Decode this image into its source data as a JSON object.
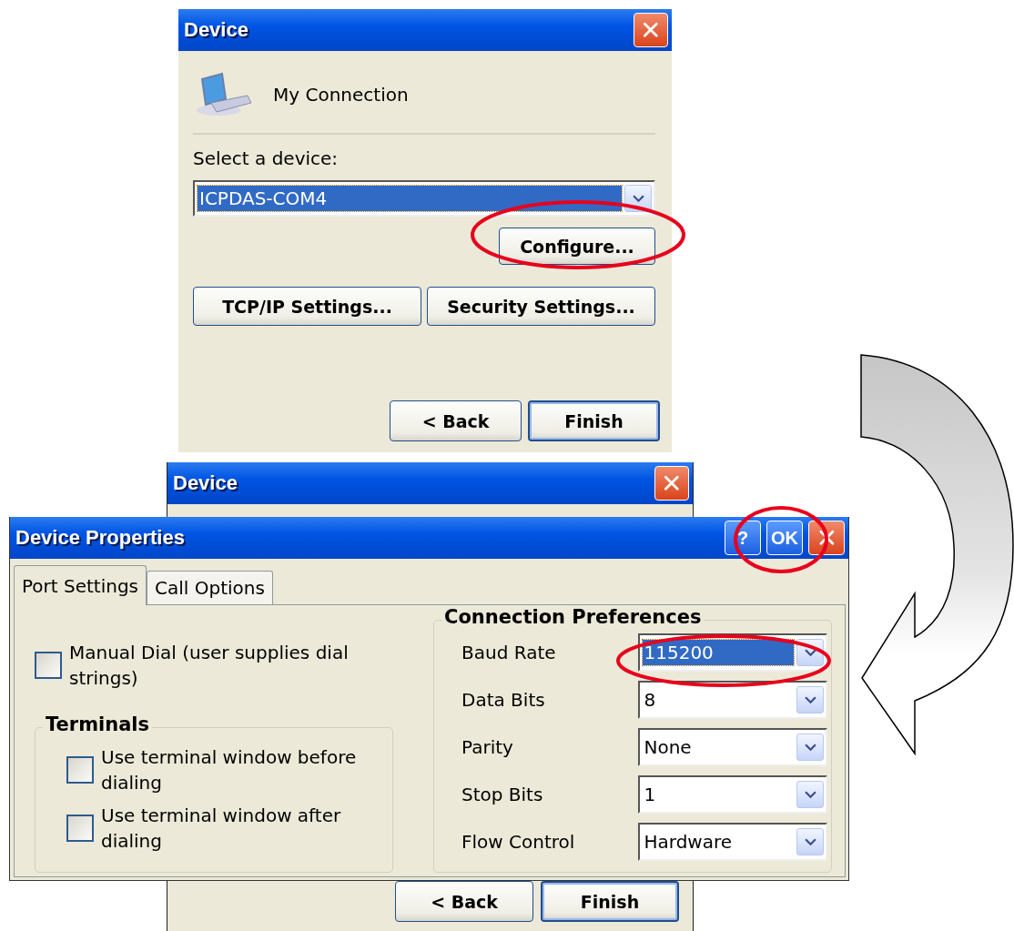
{
  "top_window": {
    "title": "Device",
    "connection_name": "My Connection",
    "select_label": "Select a device:",
    "device_dropdown": {
      "value": "ICPDAS-COM4",
      "highlighted": true
    },
    "configure_button": "Configure...",
    "settings_buttons": [
      "TCP/IP Settings...",
      "Security Settings..."
    ],
    "nav_buttons": [
      {
        "label": "< Back",
        "default": false
      },
      {
        "label": "Finish",
        "default": true
      }
    ]
  },
  "back_window": {
    "title": "Device",
    "nav_buttons": [
      {
        "label": "< Back",
        "default": false
      },
      {
        "label": "Finish",
        "default": true
      }
    ]
  },
  "properties_dialog": {
    "title": "Device Properties",
    "help_button": "?",
    "ok_button": "OK",
    "tabs": [
      {
        "label": "Port Settings",
        "selected": true
      },
      {
        "label": "Call Options",
        "selected": false
      }
    ],
    "manual_dial": {
      "label": "Manual Dial (user supplies dial strings)",
      "checked": false
    },
    "terminals": {
      "title": "Terminals",
      "options": [
        {
          "label": "Use terminal window before dialing",
          "checked": false
        },
        {
          "label": "Use terminal window after dialing",
          "checked": false
        }
      ]
    },
    "preferences": {
      "title": "Connection Preferences",
      "fields": [
        {
          "label": "Baud Rate",
          "value": "115200",
          "highlighted": true
        },
        {
          "label": "Data Bits",
          "value": "8",
          "highlighted": false
        },
        {
          "label": "Parity",
          "value": "None",
          "highlighted": false
        },
        {
          "label": "Stop Bits",
          "value": "1",
          "highlighted": false
        },
        {
          "label": "Flow Control",
          "value": "Hardware",
          "highlighted": false
        }
      ]
    }
  }
}
